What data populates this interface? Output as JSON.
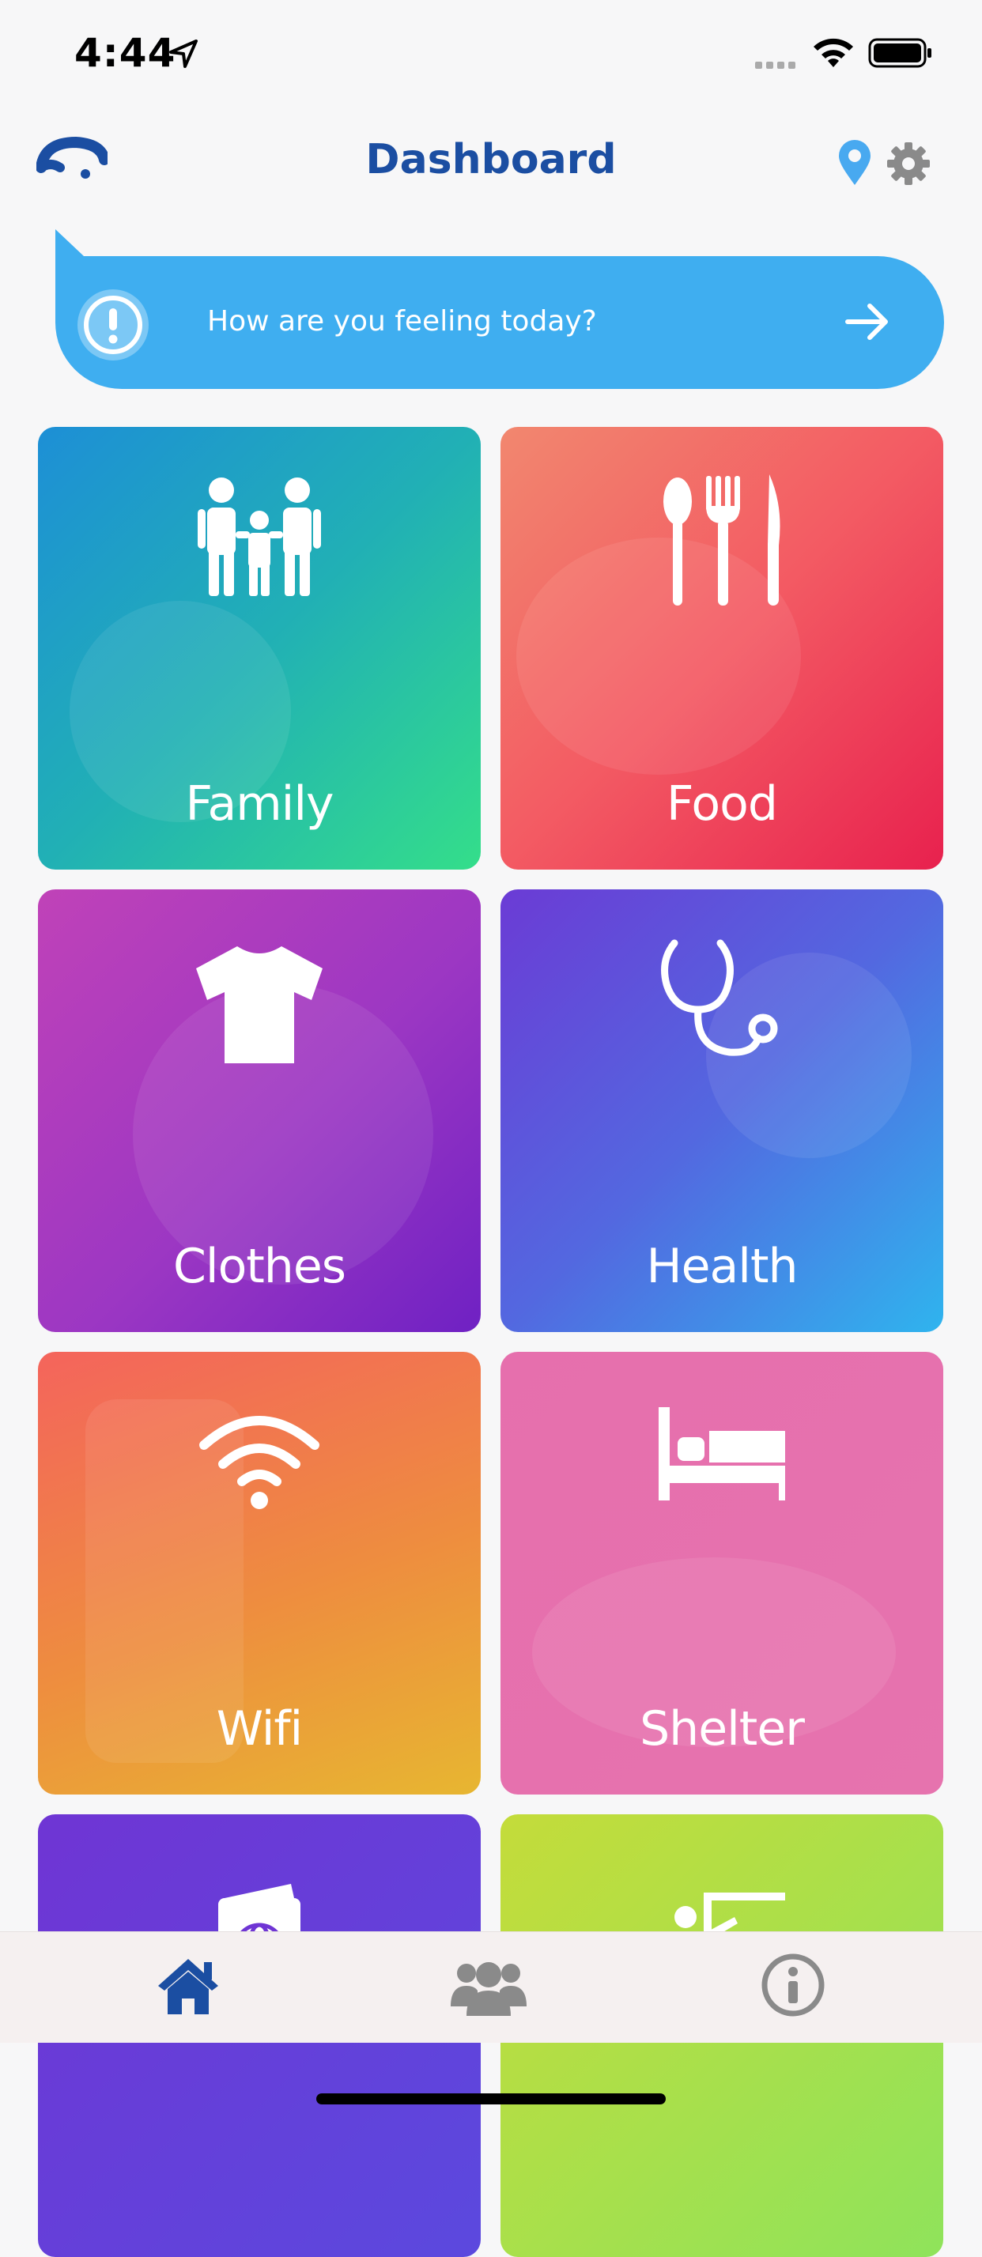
{
  "status_bar": {
    "time": "4:44"
  },
  "header": {
    "title": "Dashboard"
  },
  "banner": {
    "text": "How are you feeling today?"
  },
  "tiles": [
    {
      "label": "Family",
      "icon": "family-icon"
    },
    {
      "label": "Food",
      "icon": "utensils-icon"
    },
    {
      "label": "Clothes",
      "icon": "tshirt-icon"
    },
    {
      "label": "Health",
      "icon": "stethoscope-icon"
    },
    {
      "label": "Wifi",
      "icon": "wifi-icon"
    },
    {
      "label": "Shelter",
      "icon": "bed-icon"
    },
    {
      "label": "",
      "icon": "passport-icon"
    },
    {
      "label": "",
      "icon": "teacher-icon"
    }
  ],
  "tab_bar": {
    "items": [
      {
        "icon": "home-icon",
        "active": true
      },
      {
        "icon": "community-icon",
        "active": false
      },
      {
        "icon": "info-icon",
        "active": false
      }
    ]
  },
  "colors": {
    "brand_blue": "#1b4ea2",
    "banner_blue": "#3faef0",
    "pin_blue": "#48a9f0",
    "gear_gray": "#8a8a8a",
    "tab_inactive": "#8a8a8a"
  }
}
